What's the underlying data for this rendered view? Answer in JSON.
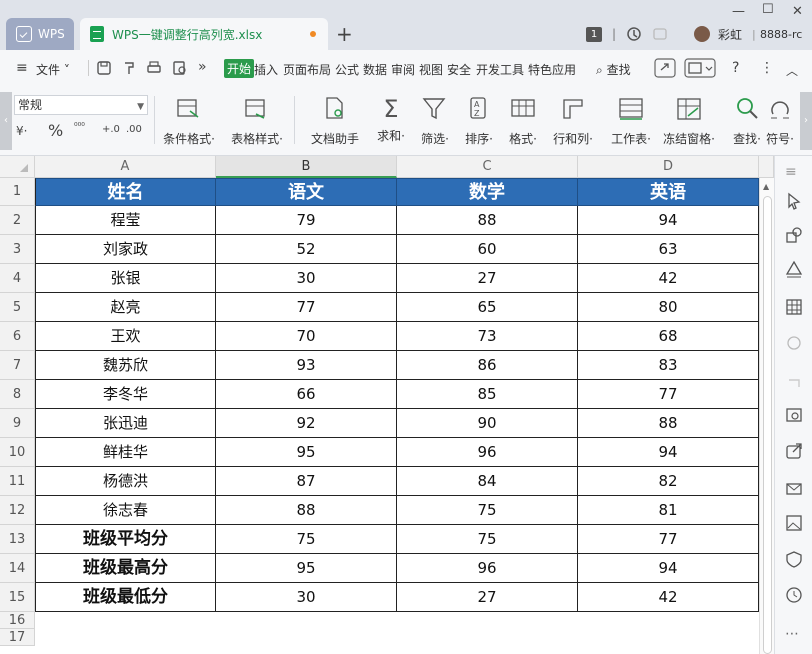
{
  "titlebar": {
    "app_tab": "WPS",
    "doc_tab": "WPS一键调整行高列宽.xlsx",
    "new_tab": "+",
    "badge": "1",
    "user_name": "彩虹",
    "user_id": "8888-rc"
  },
  "menubar": {
    "file": "文件",
    "tabs": [
      "开始",
      "插入",
      "页面布局",
      "公式",
      "数据",
      "审阅",
      "视图",
      "安全",
      "开发工具",
      "特色应用"
    ],
    "active_tab": "开始",
    "search": "查找",
    "help": "?"
  },
  "ribbon": {
    "number_format": "常规",
    "small_row": [
      "¥·",
      "%",
      "⁰⁰⁰",
      "+.0",
      ".00"
    ],
    "tools": [
      {
        "label": "条件格式·",
        "icon": "conditional-format-icon"
      },
      {
        "label": "表格样式·",
        "icon": "table-style-icon"
      },
      {
        "label": "文档助手",
        "icon": "doc-assistant-icon"
      },
      {
        "label": "求和·",
        "icon": "sum-icon"
      },
      {
        "label": "筛选·",
        "icon": "filter-icon"
      },
      {
        "label": "排序·",
        "icon": "sort-icon"
      },
      {
        "label": "格式·",
        "icon": "format-icon"
      },
      {
        "label": "行和列·",
        "icon": "row-col-icon"
      },
      {
        "label": "工作表·",
        "icon": "worksheet-icon"
      },
      {
        "label": "冻结窗格·",
        "icon": "freeze-pane-icon"
      },
      {
        "label": "查找·",
        "icon": "find-icon"
      },
      {
        "label": "符号·",
        "icon": "symbol-icon"
      }
    ]
  },
  "sheet": {
    "columns": [
      "A",
      "B",
      "C",
      "D"
    ],
    "selected_column": "B",
    "header": [
      "姓名",
      "语文",
      "数学",
      "英语"
    ],
    "rows": [
      [
        "程莹",
        "79",
        "88",
        "94"
      ],
      [
        "刘家政",
        "52",
        "60",
        "63"
      ],
      [
        "张银",
        "30",
        "27",
        "42"
      ],
      [
        "赵亮",
        "77",
        "65",
        "80"
      ],
      [
        "王欢",
        "70",
        "73",
        "68"
      ],
      [
        "魏苏欣",
        "93",
        "86",
        "83"
      ],
      [
        "李冬华",
        "66",
        "85",
        "77"
      ],
      [
        "张迅迪",
        "92",
        "90",
        "88"
      ],
      [
        "鲜桂华",
        "95",
        "96",
        "94"
      ],
      [
        "杨德洪",
        "87",
        "84",
        "82"
      ],
      [
        "徐志春",
        "88",
        "75",
        "81"
      ],
      [
        "班级平均分",
        "75",
        "75",
        "77"
      ],
      [
        "班级最高分",
        "95",
        "96",
        "94"
      ],
      [
        "班级最低分",
        "30",
        "27",
        "42"
      ]
    ],
    "row_numbers": [
      "1",
      "2",
      "3",
      "4",
      "5",
      "6",
      "7",
      "8",
      "9",
      "10",
      "11",
      "12",
      "13",
      "14",
      "15",
      "16",
      "17"
    ]
  },
  "colors": {
    "header_fill": "#2d6db5",
    "accent_green": "#2b9b4c",
    "titlebar_bg": "#dfe3ea"
  }
}
